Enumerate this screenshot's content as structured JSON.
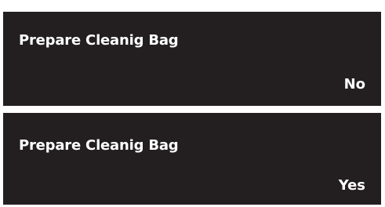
{
  "screens": [
    {
      "title": "Prepare Cleanig Bag",
      "value": "No"
    },
    {
      "title": "Prepare Cleanig Bag",
      "value": "Yes"
    }
  ],
  "colors": {
    "screen_background": "#231f20",
    "text": "#ffffff",
    "page_background": "#ffffff"
  }
}
